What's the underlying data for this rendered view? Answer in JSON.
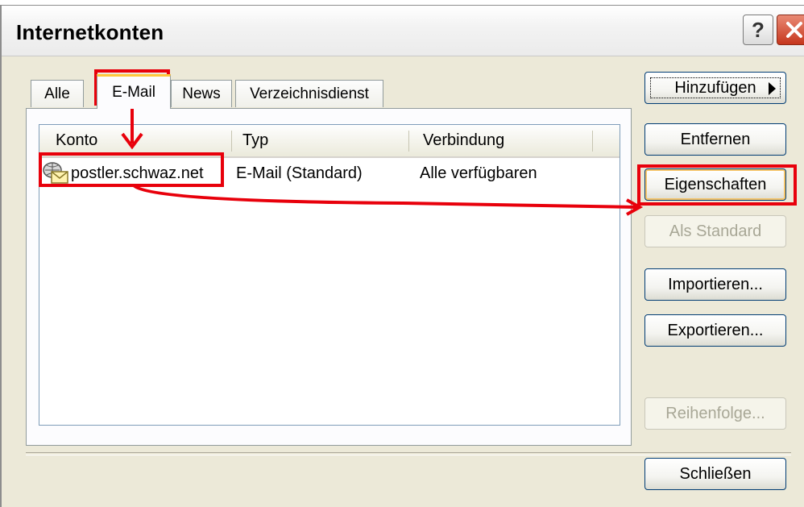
{
  "window": {
    "title": "Internetkonten",
    "help_label": "?"
  },
  "tabs": [
    {
      "label": "Alle",
      "active": false
    },
    {
      "label": "E-Mail",
      "active": true
    },
    {
      "label": "News",
      "active": false
    },
    {
      "label": "Verzeichnisdienst",
      "active": false
    }
  ],
  "accounts_list": {
    "columns": [
      "Konto",
      "Typ",
      "Verbindung"
    ],
    "rows": [
      {
        "konto": "postler.schwaz.net",
        "typ": "E-Mail (Standard)",
        "verbindung": "Alle verfügbaren",
        "icon": "mail-account-icon"
      }
    ]
  },
  "buttons": {
    "add": "Hinzufügen",
    "remove": "Entfernen",
    "properties": "Eigenschaften",
    "set_default": "Als Standard",
    "import": "Importieren...",
    "export": "Exportieren...",
    "order": "Reihenfolge...",
    "close": "Schließen"
  },
  "colors": {
    "annotation_red": "#e8000b",
    "dialog_bg": "#ece9d8",
    "button_border": "#003c74",
    "active_tab_highlight": "#ffc83c"
  }
}
